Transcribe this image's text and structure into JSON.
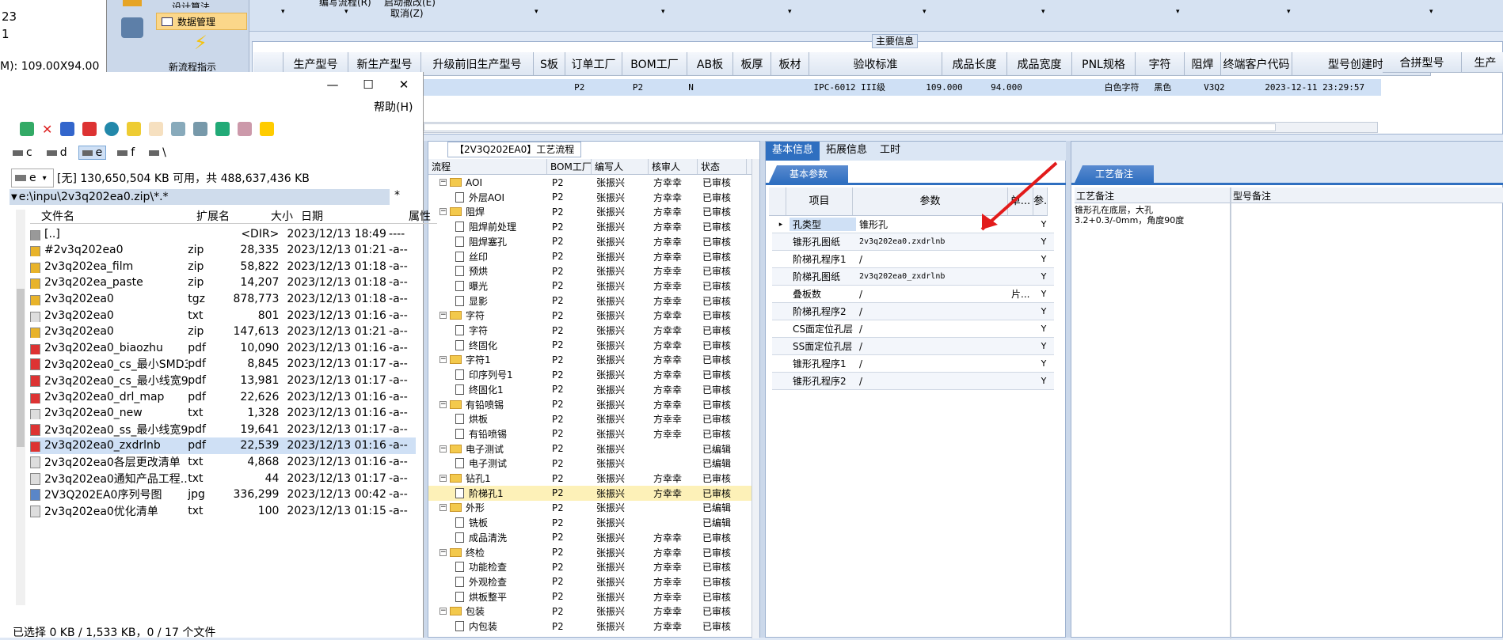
{
  "top_left": {
    "line1": "23",
    "line2": "1",
    "dims_text": "M): 109.00X94.00"
  },
  "top_menu": {
    "item1": "设计算法",
    "item2": "数据管理",
    "new_flow": "新流程指示",
    "cut1": "编写流程(R)",
    "cut2": "启动撤改(E)",
    "cancel": "取消(Z)"
  },
  "main_info": {
    "section_title": "主要信息",
    "columns": [
      "生产型号",
      "新生产型号",
      "升级前旧生产型号",
      "S板",
      "订单工厂",
      "BOM工厂",
      "AB板",
      "板厚",
      "板材",
      "验收标准",
      "成品长度",
      "成品宽度",
      "PNL规格",
      "字符",
      "阻焊",
      "终端客户代码",
      "型号创建时间"
    ],
    "row": [
      "",
      "",
      "",
      "",
      "P2",
      "P2",
      "N",
      "",
      "",
      "IPC-6012 III级",
      "109.000",
      "94.000",
      "",
      "白色字符",
      "黑色",
      "V3Q2",
      "2023-12-11 23:29:57"
    ],
    "extra_columns": [
      "合拼型号",
      "生产"
    ]
  },
  "file_manager": {
    "help_menu": "帮助(H)",
    "drives": [
      "c",
      "d",
      "e",
      "f",
      "\\"
    ],
    "drive_select": "e",
    "free_space": "[无]  130,650,504 KB 可用，共 488,637,436 KB",
    "path": "e:\\inpu\\2v3q202ea0.zip\\*.*",
    "path_filter": "*",
    "columns": {
      "name": "文件名",
      "ext": "扩展名",
      "size": "大小",
      "date": "日期",
      "attr": "属性"
    },
    "files": [
      {
        "name": "[..]",
        "ext": "",
        "size": "<DIR>",
        "date": "2023/12/13 18:49",
        "attr": "----",
        "icon": "up-icon"
      },
      {
        "name": "#2v3q202ea0",
        "ext": "zip",
        "size": "28,335",
        "date": "2023/12/13 01:21",
        "attr": "-a--",
        "icon": "zip-icon"
      },
      {
        "name": "2v3q202ea_film",
        "ext": "zip",
        "size": "58,822",
        "date": "2023/12/13 01:18",
        "attr": "-a--",
        "icon": "zip-icon"
      },
      {
        "name": "2v3q202ea_paste",
        "ext": "zip",
        "size": "14,207",
        "date": "2023/12/13 01:18",
        "attr": "-a--",
        "icon": "zip-icon"
      },
      {
        "name": "2v3q202ea0",
        "ext": "tgz",
        "size": "878,773",
        "date": "2023/12/13 01:18",
        "attr": "-a--",
        "icon": "zip-icon"
      },
      {
        "name": "2v3q202ea0",
        "ext": "txt",
        "size": "801",
        "date": "2023/12/13 01:16",
        "attr": "-a--",
        "icon": "txt-icon"
      },
      {
        "name": "2v3q202ea0",
        "ext": "zip",
        "size": "147,613",
        "date": "2023/12/13 01:21",
        "attr": "-a--",
        "icon": "zip-icon"
      },
      {
        "name": "2v3q202ea0_biaozhu",
        "ext": "pdf",
        "size": "10,090",
        "date": "2023/12/13 01:16",
        "attr": "-a--",
        "icon": "pdf-icon"
      },
      {
        "name": "2v3q202ea0_cs_最小SMD3...",
        "ext": "pdf",
        "size": "8,845",
        "date": "2023/12/13 01:17",
        "attr": "-a--",
        "icon": "pdf-icon"
      },
      {
        "name": "2v3q202ea0_cs_最小线宽9...",
        "ext": "pdf",
        "size": "13,981",
        "date": "2023/12/13 01:17",
        "attr": "-a--",
        "icon": "pdf-icon"
      },
      {
        "name": "2v3q202ea0_drl_map",
        "ext": "pdf",
        "size": "22,626",
        "date": "2023/12/13 01:16",
        "attr": "-a--",
        "icon": "pdf-icon"
      },
      {
        "name": "2v3q202ea0_new",
        "ext": "txt",
        "size": "1,328",
        "date": "2023/12/13 01:16",
        "attr": "-a--",
        "icon": "txt-icon"
      },
      {
        "name": "2v3q202ea0_ss_最小线宽9...",
        "ext": "pdf",
        "size": "19,641",
        "date": "2023/12/13 01:17",
        "attr": "-a--",
        "icon": "pdf-icon"
      },
      {
        "name": "2v3q202ea0_zxdrlnb",
        "ext": "pdf",
        "size": "22,539",
        "date": "2023/12/13 01:16",
        "attr": "-a--",
        "icon": "pdf-icon"
      },
      {
        "name": "2v3q202ea0各层更改清单",
        "ext": "txt",
        "size": "4,868",
        "date": "2023/12/13 01:16",
        "attr": "-a--",
        "icon": "txt-icon"
      },
      {
        "name": "2v3q202ea0通知产品工程...",
        "ext": "txt",
        "size": "44",
        "date": "2023/12/13 01:17",
        "attr": "-a--",
        "icon": "txt-icon"
      },
      {
        "name": "2V3Q202EA0序列号图",
        "ext": "jpg",
        "size": "336,299",
        "date": "2023/12/13 00:42",
        "attr": "-a--",
        "icon": "jpg-icon"
      },
      {
        "name": "2v3q202ea0优化清单",
        "ext": "txt",
        "size": "100",
        "date": "2023/12/13 01:15",
        "attr": "-a--",
        "icon": "txt-icon"
      }
    ],
    "status": "已选择 0 KB / 1,533 KB，0 / 17 个文件"
  },
  "flow": {
    "tab_title": "【2V3Q202EA0】工艺流程",
    "columns": [
      "流程",
      "BOM工厂",
      "编写人",
      "核审人",
      "状态"
    ],
    "rows": [
      {
        "level": 0,
        "kind": "folder",
        "name": "AOI",
        "bom": "P2",
        "writer": "张振兴",
        "reviewer": "方幸幸",
        "status": "已审核"
      },
      {
        "level": 1,
        "kind": "doc",
        "name": "外层AOI",
        "bom": "P2",
        "writer": "张振兴",
        "reviewer": "方幸幸",
        "status": "已审核"
      },
      {
        "level": 0,
        "kind": "folder",
        "name": "阻焊",
        "bom": "P2",
        "writer": "张振兴",
        "reviewer": "方幸幸",
        "status": "已审核"
      },
      {
        "level": 1,
        "kind": "doc",
        "name": "阻焊前处理",
        "bom": "P2",
        "writer": "张振兴",
        "reviewer": "方幸幸",
        "status": "已审核"
      },
      {
        "level": 1,
        "kind": "doc",
        "name": "阻焊塞孔",
        "bom": "P2",
        "writer": "张振兴",
        "reviewer": "方幸幸",
        "status": "已审核"
      },
      {
        "level": 1,
        "kind": "doc",
        "name": "丝印",
        "bom": "P2",
        "writer": "张振兴",
        "reviewer": "方幸幸",
        "status": "已审核"
      },
      {
        "level": 1,
        "kind": "doc",
        "name": "预烘",
        "bom": "P2",
        "writer": "张振兴",
        "reviewer": "方幸幸",
        "status": "已审核"
      },
      {
        "level": 1,
        "kind": "doc",
        "name": "曝光",
        "bom": "P2",
        "writer": "张振兴",
        "reviewer": "方幸幸",
        "status": "已审核"
      },
      {
        "level": 1,
        "kind": "doc",
        "name": "显影",
        "bom": "P2",
        "writer": "张振兴",
        "reviewer": "方幸幸",
        "status": "已审核"
      },
      {
        "level": 0,
        "kind": "folder",
        "name": "字符",
        "bom": "P2",
        "writer": "张振兴",
        "reviewer": "方幸幸",
        "status": "已审核"
      },
      {
        "level": 1,
        "kind": "doc",
        "name": "字符",
        "bom": "P2",
        "writer": "张振兴",
        "reviewer": "方幸幸",
        "status": "已审核"
      },
      {
        "level": 1,
        "kind": "doc",
        "name": "终固化",
        "bom": "P2",
        "writer": "张振兴",
        "reviewer": "方幸幸",
        "status": "已审核"
      },
      {
        "level": 0,
        "kind": "folder",
        "name": "字符1",
        "bom": "P2",
        "writer": "张振兴",
        "reviewer": "方幸幸",
        "status": "已审核"
      },
      {
        "level": 1,
        "kind": "doc",
        "name": "印序列号1",
        "bom": "P2",
        "writer": "张振兴",
        "reviewer": "方幸幸",
        "status": "已审核"
      },
      {
        "level": 1,
        "kind": "doc",
        "name": "终固化1",
        "bom": "P2",
        "writer": "张振兴",
        "reviewer": "方幸幸",
        "status": "已审核"
      },
      {
        "level": 0,
        "kind": "folder",
        "name": "有铅喷锡",
        "bom": "P2",
        "writer": "张振兴",
        "reviewer": "方幸幸",
        "status": "已审核"
      },
      {
        "level": 1,
        "kind": "doc",
        "name": "烘板",
        "bom": "P2",
        "writer": "张振兴",
        "reviewer": "方幸幸",
        "status": "已审核"
      },
      {
        "level": 1,
        "kind": "doc",
        "name": "有铅喷锡",
        "bom": "P2",
        "writer": "张振兴",
        "reviewer": "方幸幸",
        "status": "已审核"
      },
      {
        "level": 0,
        "kind": "folder",
        "name": "电子测试",
        "bom": "P2",
        "writer": "张振兴",
        "reviewer": "",
        "status": "已编辑"
      },
      {
        "level": 1,
        "kind": "doc",
        "name": "电子测试",
        "bom": "P2",
        "writer": "张振兴",
        "reviewer": "",
        "status": "已编辑"
      },
      {
        "level": 0,
        "kind": "folder",
        "name": "钻孔1",
        "bom": "P2",
        "writer": "张振兴",
        "reviewer": "方幸幸",
        "status": "已审核"
      },
      {
        "level": 1,
        "kind": "doc",
        "name": "阶梯孔1",
        "bom": "P2",
        "writer": "张振兴",
        "reviewer": "方幸幸",
        "status": "已审核",
        "selected": true
      },
      {
        "level": 0,
        "kind": "folder",
        "name": "外形",
        "bom": "P2",
        "writer": "张振兴",
        "reviewer": "",
        "status": "已编辑"
      },
      {
        "level": 1,
        "kind": "doc",
        "name": "铣板",
        "bom": "P2",
        "writer": "张振兴",
        "reviewer": "",
        "status": "已编辑"
      },
      {
        "level": 1,
        "kind": "doc",
        "name": "成品清洗",
        "bom": "P2",
        "writer": "张振兴",
        "reviewer": "方幸幸",
        "status": "已审核"
      },
      {
        "level": 0,
        "kind": "folder",
        "name": "终检",
        "bom": "P2",
        "writer": "张振兴",
        "reviewer": "方幸幸",
        "status": "已审核"
      },
      {
        "level": 1,
        "kind": "doc",
        "name": "功能检查",
        "bom": "P2",
        "writer": "张振兴",
        "reviewer": "方幸幸",
        "status": "已审核"
      },
      {
        "level": 1,
        "kind": "doc",
        "name": "外观检查",
        "bom": "P2",
        "writer": "张振兴",
        "reviewer": "方幸幸",
        "status": "已审核"
      },
      {
        "level": 1,
        "kind": "doc",
        "name": "烘板整平",
        "bom": "P2",
        "writer": "张振兴",
        "reviewer": "方幸幸",
        "status": "已审核"
      },
      {
        "level": 0,
        "kind": "folder",
        "name": "包装",
        "bom": "P2",
        "writer": "张振兴",
        "reviewer": "方幸幸",
        "status": "已审核"
      },
      {
        "level": 1,
        "kind": "doc",
        "name": "内包装",
        "bom": "P2",
        "writer": "张振兴",
        "reviewer": "方幸幸",
        "status": "已审核"
      }
    ]
  },
  "detail": {
    "tabs": [
      "基本信息",
      "拓展信息",
      "工时"
    ],
    "sub_tab": "基本参数",
    "columns": [
      "项目",
      "参数",
      "单...",
      "参..."
    ],
    "params": [
      {
        "item": "孔类型",
        "value": "锥形孔",
        "unit": "",
        "flag": "Y"
      },
      {
        "item": "锥形孔图纸",
        "value": "2v3q202ea0.zxdrlnb",
        "unit": "",
        "flag": "Y"
      },
      {
        "item": "阶梯孔程序1",
        "value": "/",
        "unit": "",
        "flag": "Y"
      },
      {
        "item": "阶梯孔图纸",
        "value": "2v3q202ea0_zxdrlnb",
        "unit": "",
        "flag": "Y"
      },
      {
        "item": "叠板数",
        "value": "/",
        "unit": "片...",
        "flag": "Y"
      },
      {
        "item": "阶梯孔程序2",
        "value": "/",
        "unit": "",
        "flag": "Y"
      },
      {
        "item": "CS面定位孔层",
        "value": "/",
        "unit": "",
        "flag": "Y"
      },
      {
        "item": "SS面定位孔层",
        "value": "/",
        "unit": "",
        "flag": "Y"
      },
      {
        "item": "锥形孔程序1",
        "value": "/",
        "unit": "",
        "flag": "Y"
      },
      {
        "item": "锥形孔程序2",
        "value": "/",
        "unit": "",
        "flag": "Y"
      }
    ]
  },
  "remark": {
    "tab": "工艺备注",
    "col1": "工艺备注",
    "col2": "型号备注",
    "text": "锥形孔在底层，大孔3.2+0.3/-0mm，角度90度"
  },
  "colors": {
    "selected_row": "#fdf1b8",
    "header_blue": "#cfe0f5",
    "accent": "#2f6fc0",
    "arrow": "#e21b1b"
  }
}
